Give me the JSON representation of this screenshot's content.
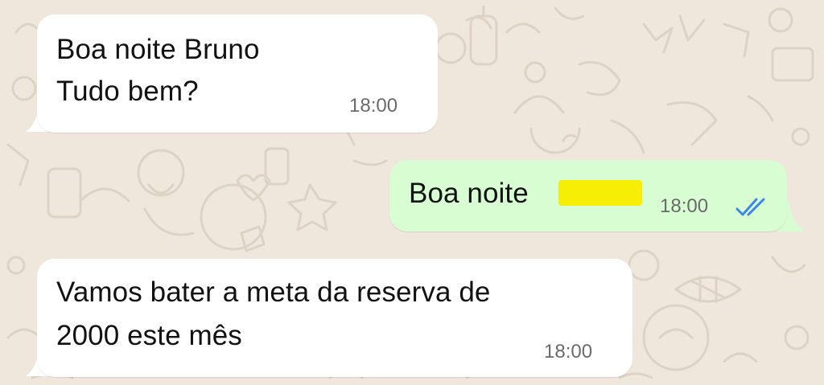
{
  "chat": {
    "messages": [
      {
        "direction": "incoming",
        "lines": [
          "Boa noite Bruno",
          "Tudo bem?"
        ],
        "time": "18:00"
      },
      {
        "direction": "outgoing",
        "lines": [
          "Boa noite"
        ],
        "time": "18:00",
        "read_status": "read",
        "redacted_name": true
      },
      {
        "direction": "incoming",
        "lines": [
          "Vamos bater a meta da reserva de",
          "2000 este mês"
        ],
        "time": "18:00"
      }
    ]
  },
  "colors": {
    "wallpaper": "#efe7dc",
    "incoming_bubble": "#ffffff",
    "outgoing_bubble": "#d9fdd3",
    "timestamp": "#6a6a6a",
    "read_ticks": "#3d86e8",
    "redaction_highlight": "#f6ef05"
  },
  "icons": {
    "read_receipt": "double-check-icon"
  }
}
